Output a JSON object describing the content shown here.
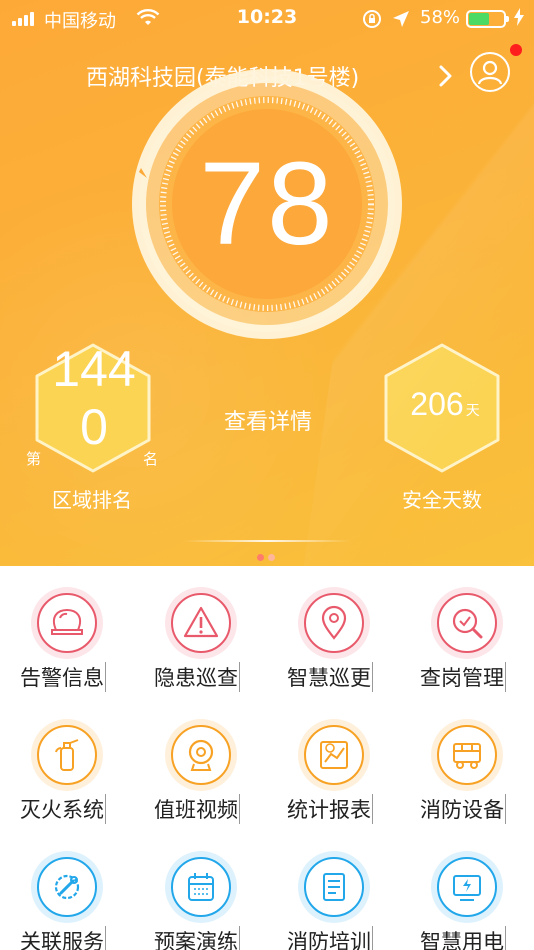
{
  "status_bar": {
    "carrier": "中国移动",
    "time": "10:23",
    "battery_percent": "58%",
    "battery_level": 0.58
  },
  "header": {
    "site_title": "西湖科技园(泰能科技1号楼)",
    "score": "78"
  },
  "stats": {
    "rank_value": "1440",
    "rank_prefix": "第",
    "rank_suffix": "名",
    "rank_label": "区域排名",
    "details_link": "查看详情",
    "safe_days_value": "206",
    "safe_days_unit": "天",
    "safe_days_label": "安全天数"
  },
  "pager": {
    "pages": 2,
    "current": 1
  },
  "colors": {
    "header_orange": "#fda938",
    "red_icon": "#e85a6b",
    "orange_icon": "#f7a224",
    "blue_icon": "#21a7ea",
    "hex_fill": "#fbd453"
  },
  "menu": [
    {
      "label": "告警信息",
      "icon": "alarm-bell-icon",
      "color": "red"
    },
    {
      "label": "隐患巡查",
      "icon": "warning-triangle-icon",
      "color": "red"
    },
    {
      "label": "智慧巡更",
      "icon": "location-pin-icon",
      "color": "red"
    },
    {
      "label": "查岗管理",
      "icon": "search-check-icon",
      "color": "red"
    },
    {
      "label": "灭火系统",
      "icon": "fire-extinguisher-icon",
      "color": "orange"
    },
    {
      "label": "值班视频",
      "icon": "webcam-icon",
      "color": "orange"
    },
    {
      "label": "统计报表",
      "icon": "chart-report-icon",
      "color": "orange"
    },
    {
      "label": "消防设备",
      "icon": "fire-truck-icon",
      "color": "orange"
    },
    {
      "label": "关联服务",
      "icon": "wrench-gear-icon",
      "color": "blue"
    },
    {
      "label": "预案演练",
      "icon": "calendar-icon",
      "color": "blue"
    },
    {
      "label": "消防培训",
      "icon": "document-icon",
      "color": "blue"
    },
    {
      "label": "智慧用电",
      "icon": "power-monitor-icon",
      "color": "blue"
    }
  ]
}
